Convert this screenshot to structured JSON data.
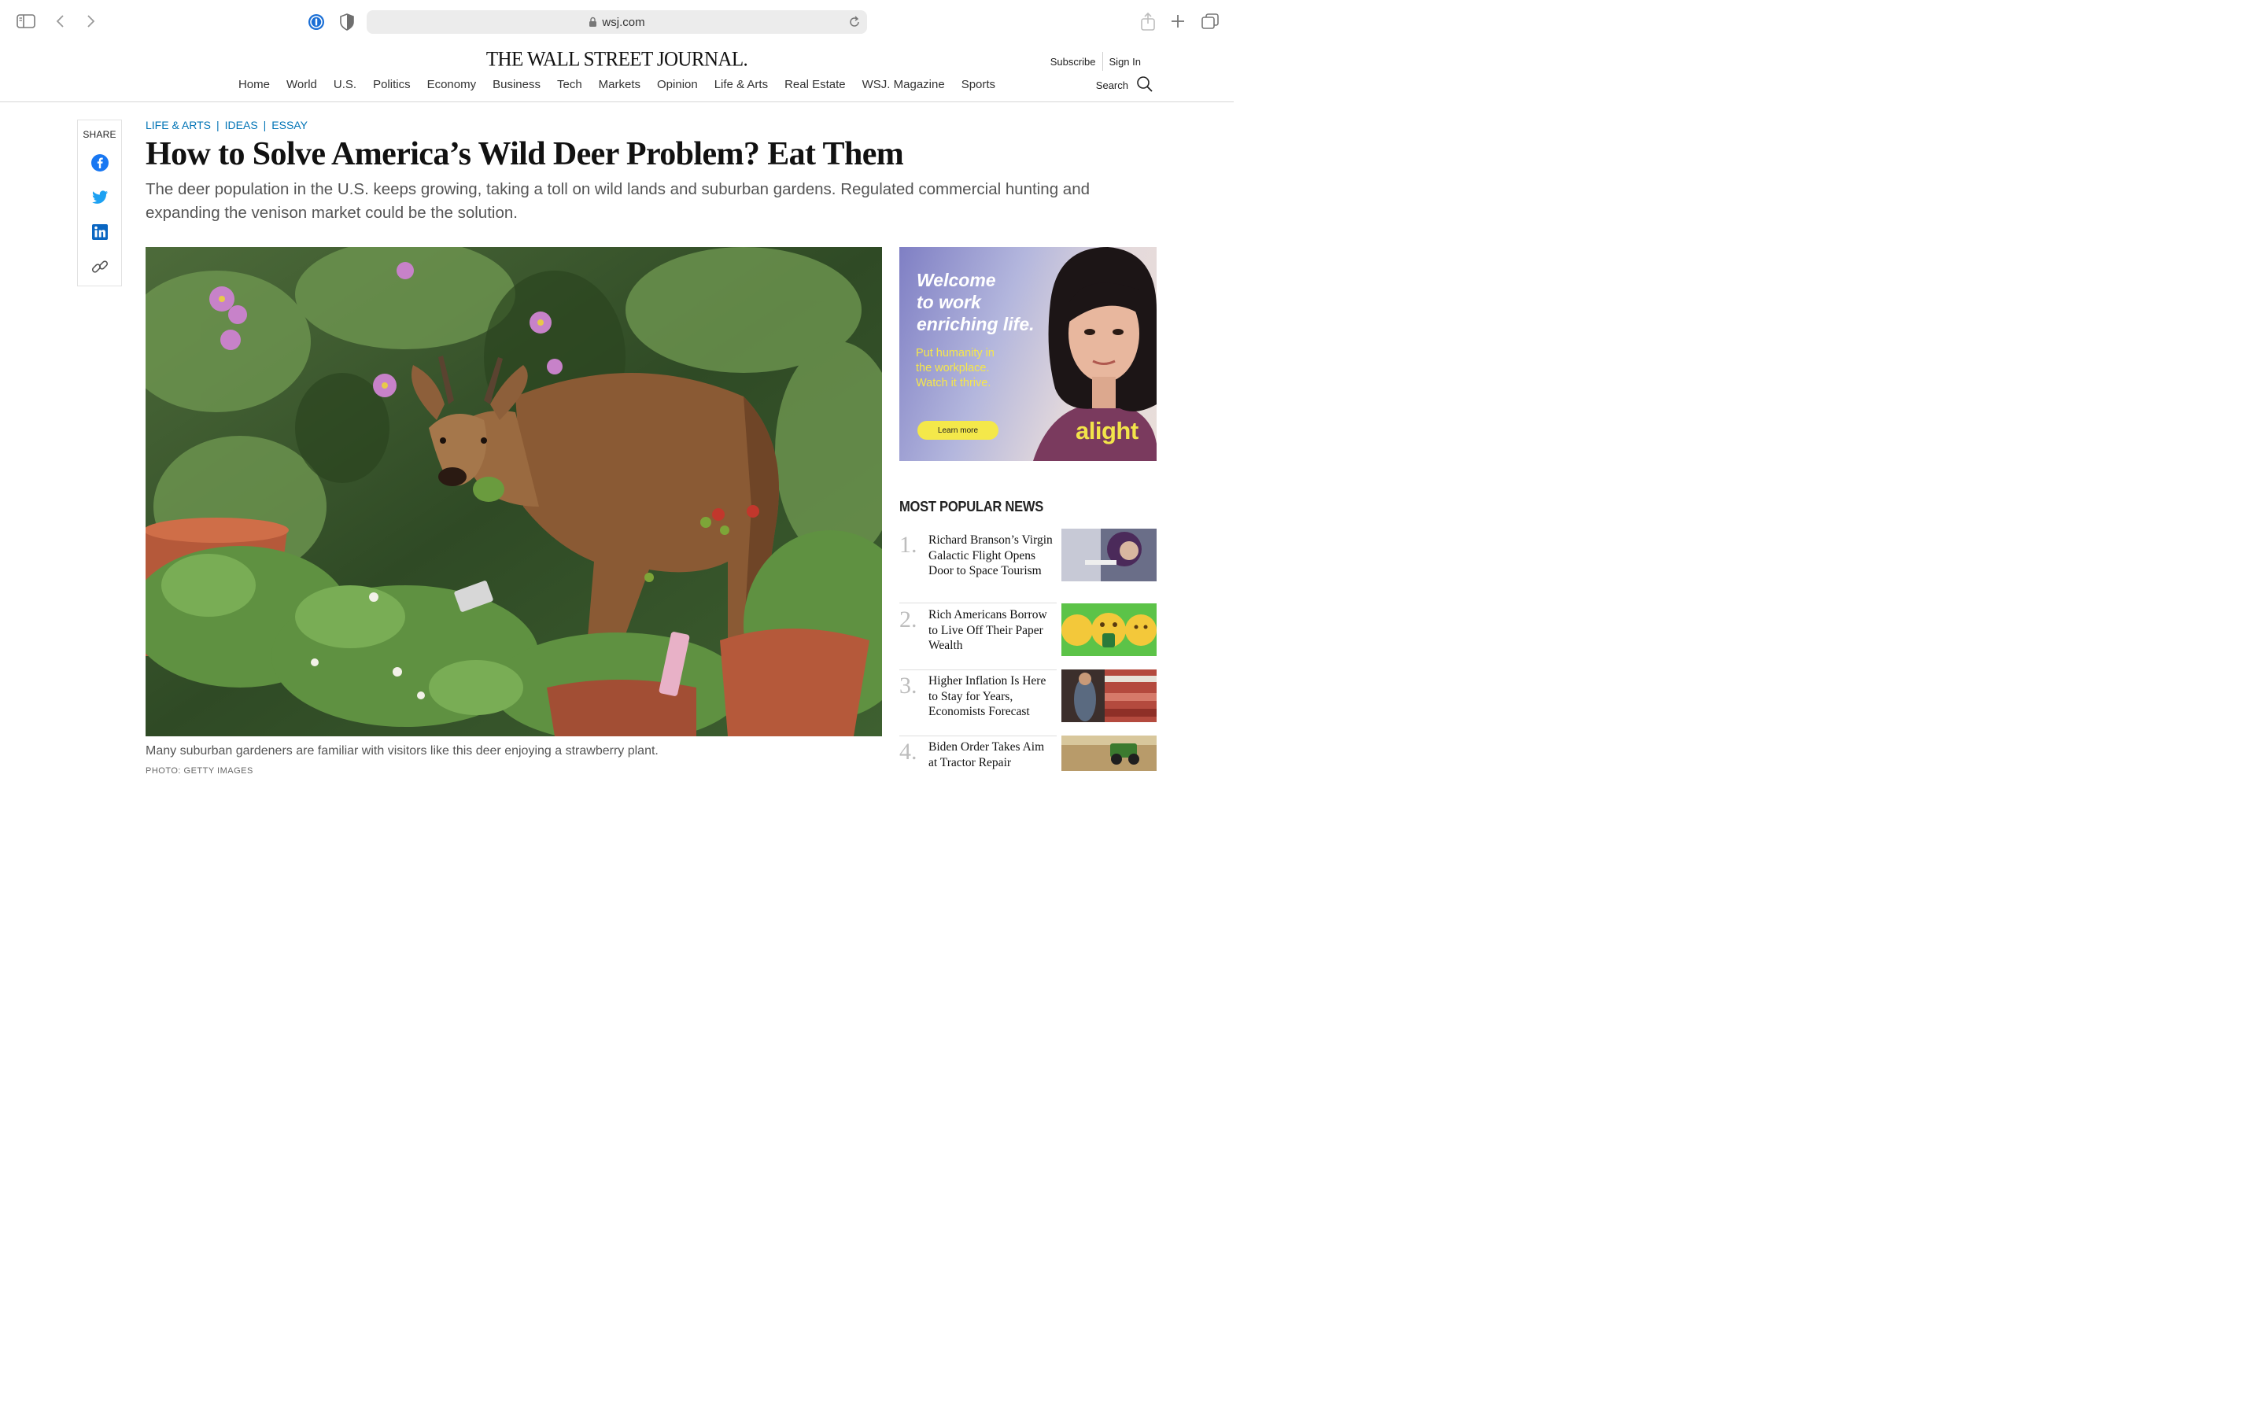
{
  "browser": {
    "url": "wsj.com"
  },
  "header": {
    "logo": "THE WALL STREET JOURNAL.",
    "subscribe": "Subscribe",
    "sign_in": "Sign In",
    "search_label": "Search",
    "nav": [
      "Home",
      "World",
      "U.S.",
      "Politics",
      "Economy",
      "Business",
      "Tech",
      "Markets",
      "Opinion",
      "Life & Arts",
      "Real Estate",
      "WSJ. Magazine",
      "Sports"
    ]
  },
  "share": {
    "label": "SHARE",
    "icons": [
      "facebook-icon",
      "twitter-icon",
      "linkedin-icon",
      "link-icon"
    ]
  },
  "article": {
    "breadcrumbs": [
      "LIFE & ARTS",
      "IDEAS",
      "ESSAY"
    ],
    "headline": "How to Solve America’s Wild Deer Problem? Eat Them",
    "dek": "The deer population in the U.S. keeps growing, taking a toll on wild lands and suburban gardens. Regulated commercial hunting and expanding the venison market could be the solution.",
    "caption": "Many suburban gardeners are familiar with visitors like this deer enjoying a strawberry plant.",
    "credit": "PHOTO: GETTY IMAGES"
  },
  "ad": {
    "headline_lines": [
      "Welcome",
      "to work",
      "enriching life."
    ],
    "sub_lines": [
      "Put humanity in",
      "the workplace.",
      "Watch it thrive."
    ],
    "button": "Learn more",
    "brand": "alight",
    "colors": {
      "accent": "#f4e84a"
    }
  },
  "most_popular": {
    "title": "MOST POPULAR NEWS",
    "items": [
      {
        "num": "1.",
        "text": "Richard Branson’s Virgin Galactic Flight Opens Door to Space Tourism"
      },
      {
        "num": "2.",
        "text": "Rich Americans Borrow to Live Off Their Paper Wealth"
      },
      {
        "num": "3.",
        "text": "Higher Inflation Is Here to Stay for Years, Economists Forecast"
      },
      {
        "num": "4.",
        "text": "Biden Order Takes Aim at Tractor Repair"
      }
    ]
  },
  "colors": {
    "link_blue": "#0274b6",
    "facebook": "#1877f2",
    "twitter": "#1da1f2",
    "linkedin": "#0a66c2"
  }
}
